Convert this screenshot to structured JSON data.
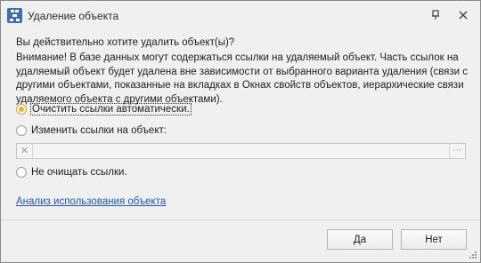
{
  "window": {
    "title": "Удаление объекта"
  },
  "dialog": {
    "question": "Вы действительно хотите удалить объект(ы)?",
    "warning": "Внимание! В базе данных могут содержаться ссылки на удаляемый объект. Часть ссылок на удаляемый объект будет удалена вне зависимости от выбранного варианта удаления (связи с другими объектами, показанные на вкладках в Окнах свойств объектов, иерархические связи удаляемого объекта с другими объектами).",
    "options": [
      {
        "label": "Очистить ссылки автоматически.",
        "selected": true
      },
      {
        "label": "Изменить ссылки на объект:",
        "selected": false
      },
      {
        "label": "Не очищать ссылки.",
        "selected": false
      }
    ],
    "object_field": {
      "value": "",
      "clear_icon": "x-icon",
      "browse_label": "···"
    },
    "analysis_link": "Анализ использования объекта"
  },
  "buttons": {
    "yes": "Да",
    "no": "Нет"
  },
  "colors": {
    "radio_selected": "#f2b01e",
    "link": "#1f56b8",
    "app_icon": "#3a6fb3"
  }
}
